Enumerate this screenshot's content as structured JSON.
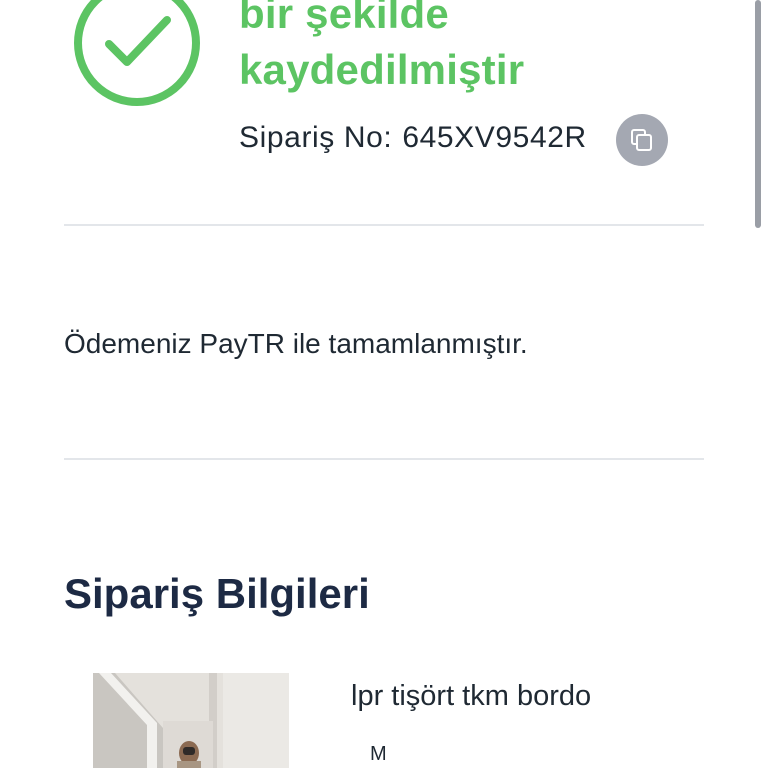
{
  "success": {
    "title_line1": "bir şekilde",
    "title_line2": "kaydedilmiştir",
    "icon": "check-circle-icon",
    "color": "#5cc463"
  },
  "order": {
    "label": "Sipariş No:",
    "number": "645XV9542R",
    "copy_icon": "copy-icon"
  },
  "payment": {
    "message": "Ödemeniz PayTR ile tamamlanmıştır."
  },
  "order_info": {
    "title": "Sipariş Bilgileri",
    "items": [
      {
        "name": "lpr tişört tkm bordo",
        "size": "M"
      }
    ]
  },
  "colors": {
    "accent_green": "#5cc463",
    "heading_navy": "#1d2a44",
    "text": "#1f2933",
    "divider": "#e3e6ea",
    "copy_button": "#a4a8b2"
  }
}
